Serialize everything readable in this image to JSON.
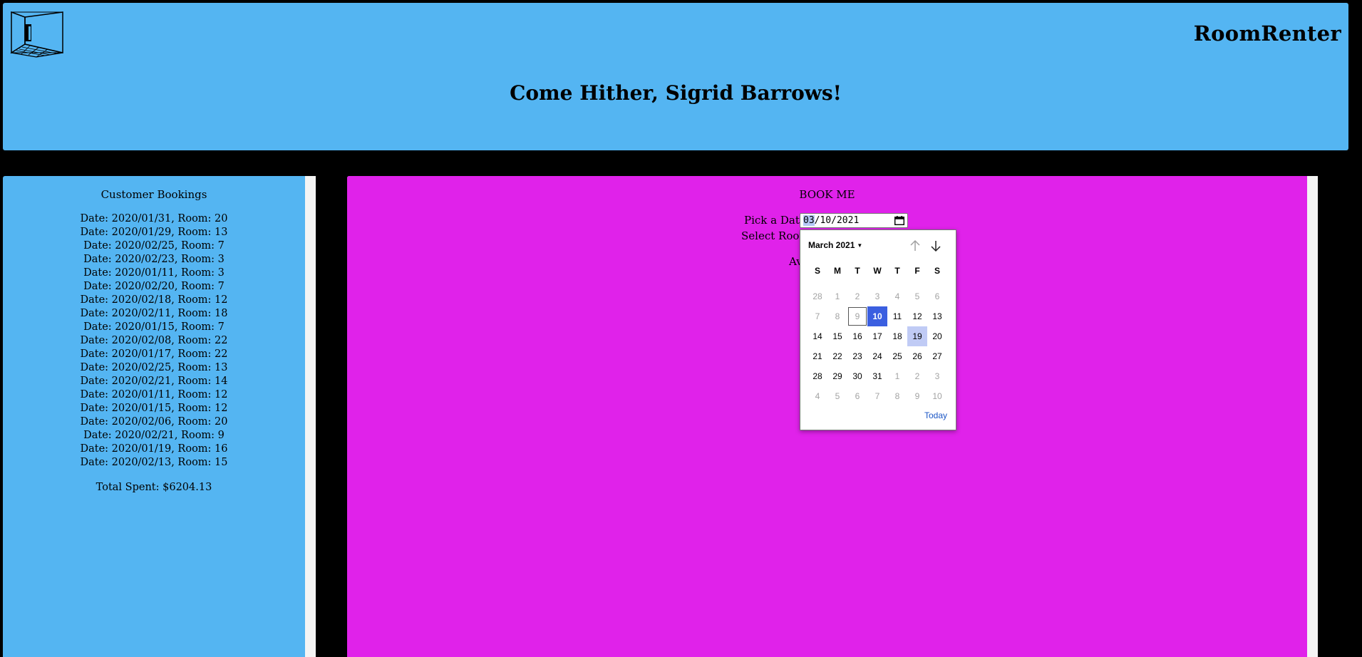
{
  "header": {
    "brand": "RoomRenter",
    "welcome": "Come Hither, Sigrid Barrows!",
    "logo_icon": "room-logo-icon",
    "background": "#54b5f2"
  },
  "sidebar": {
    "title": "Customer Bookings",
    "bookings": [
      "Date: 2020/01/31, Room: 20",
      "Date: 2020/01/29, Room: 13",
      "Date: 2020/02/25, Room: 7",
      "Date: 2020/02/23, Room: 3",
      "Date: 2020/01/11, Room: 3",
      "Date: 2020/02/20, Room: 7",
      "Date: 2020/02/18, Room: 12",
      "Date: 2020/02/11, Room: 18",
      "Date: 2020/01/15, Room: 7",
      "Date: 2020/02/08, Room: 22",
      "Date: 2020/01/17, Room: 22",
      "Date: 2020/02/25, Room: 13",
      "Date: 2020/02/21, Room: 14",
      "Date: 2020/01/11, Room: 12",
      "Date: 2020/01/15, Room: 12",
      "Date: 2020/02/06, Room: 20",
      "Date: 2020/02/21, Room: 9",
      "Date: 2020/01/19, Room: 16",
      "Date: 2020/02/13, Room: 15"
    ],
    "total": "Total Spent: $6204.13"
  },
  "main": {
    "title": "BOOK ME",
    "pick_label": "Pick a Date",
    "room_label": "Select Room",
    "avail_label": "Av",
    "date_month": "03",
    "date_rest": "/10/2021",
    "background": "#e022ea"
  },
  "picker": {
    "month_label": "March 2021",
    "weekdays": [
      "S",
      "M",
      "T",
      "W",
      "T",
      "F",
      "S"
    ],
    "weeks": [
      [
        "28",
        "1",
        "2",
        "3",
        "4",
        "5",
        "6"
      ],
      [
        "7",
        "8",
        "9",
        "10",
        "11",
        "12",
        "13"
      ],
      [
        "14",
        "15",
        "16",
        "17",
        "18",
        "19",
        "20"
      ],
      [
        "21",
        "22",
        "23",
        "24",
        "25",
        "26",
        "27"
      ],
      [
        "28",
        "29",
        "30",
        "31",
        "1",
        "2",
        "3"
      ],
      [
        "4",
        "5",
        "6",
        "7",
        "8",
        "9",
        "10"
      ]
    ],
    "muted": [
      [
        true,
        true,
        true,
        true,
        true,
        true,
        true
      ],
      [
        true,
        true,
        true,
        false,
        false,
        false,
        false
      ],
      [
        false,
        false,
        false,
        false,
        false,
        false,
        false
      ],
      [
        false,
        false,
        false,
        false,
        false,
        false,
        false
      ],
      [
        false,
        false,
        false,
        false,
        true,
        true,
        true
      ],
      [
        true,
        true,
        true,
        true,
        true,
        true,
        true
      ]
    ],
    "selected_cell": [
      1,
      3
    ],
    "today_cell": [
      1,
      2
    ],
    "hover_cell": [
      2,
      5
    ],
    "today_label": "Today",
    "selected_color": "#3b5fe0",
    "hover_color": "#c0cbf5"
  }
}
